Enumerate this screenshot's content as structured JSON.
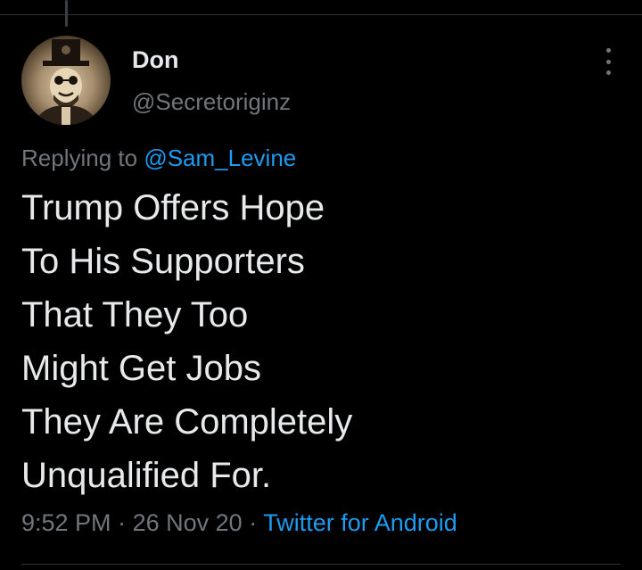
{
  "tweet": {
    "author": {
      "name": "Don",
      "handle": "@Secretoriginz",
      "avatar_icon": "user-avatar"
    },
    "reply": {
      "prefix": "Replying to",
      "mention": "@Sam_Levine"
    },
    "text_lines": [
      "Trump Offers Hope",
      "To His Supporters",
      "That They Too",
      "Might Get Jobs",
      "They Are Completely",
      "Unqualified For."
    ],
    "meta": {
      "time": "9:52 PM",
      "separator": "·",
      "date": "26 Nov 20",
      "source": "Twitter for Android"
    },
    "more_icon": "more-vertical-icon"
  },
  "colors": {
    "background": "#000000",
    "primary_text": "#e7e9ea",
    "secondary_text": "#71767b",
    "link": "#1d9bf0",
    "divider": "#2f3336"
  }
}
